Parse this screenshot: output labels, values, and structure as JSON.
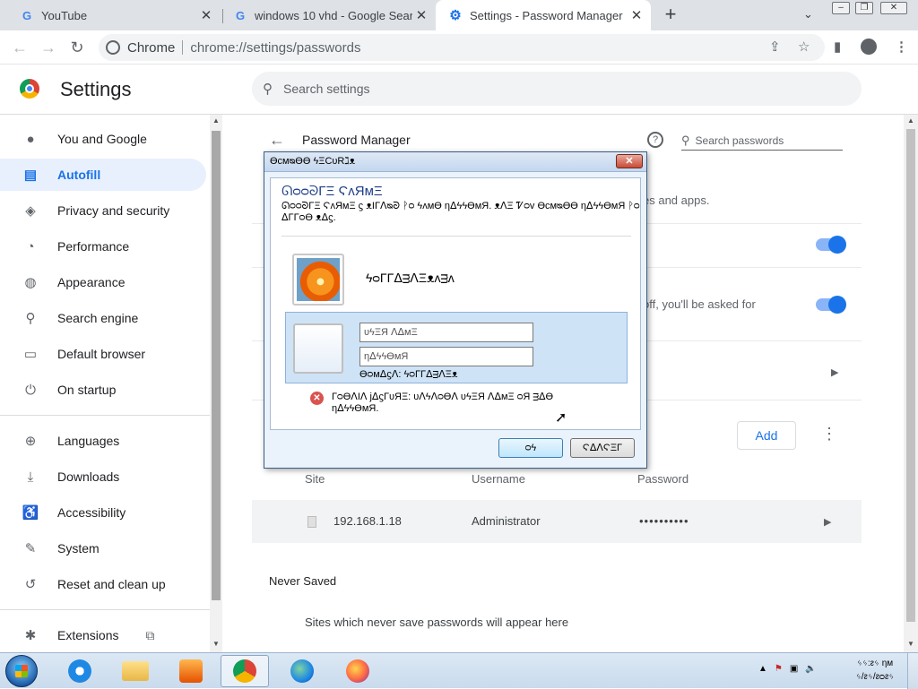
{
  "browser": {
    "tabs": [
      {
        "title": "YouTube",
        "icon": "google-icon",
        "active": false
      },
      {
        "title": "windows 10 vhd - Google Search",
        "icon": "google-icon",
        "active": false
      },
      {
        "title": "Settings - Password Manager",
        "icon": "gear-icon",
        "active": true
      }
    ],
    "omnibox": {
      "site_name": "Chrome",
      "url": "chrome://settings/passwords"
    }
  },
  "settings": {
    "title": "Settings",
    "search_placeholder": "Search settings",
    "sidebar": [
      {
        "label": "You and Google",
        "icon": "person-icon"
      },
      {
        "label": "Autofill",
        "icon": "clipboard-icon",
        "active": true
      },
      {
        "label": "Privacy and security",
        "icon": "shield-icon"
      },
      {
        "label": "Performance",
        "icon": "speedometer-icon"
      },
      {
        "label": "Appearance",
        "icon": "palette-icon"
      },
      {
        "label": "Search engine",
        "icon": "search-icon"
      },
      {
        "label": "Default browser",
        "icon": "browser-window-icon"
      },
      {
        "label": "On startup",
        "icon": "power-icon"
      },
      {
        "label": "Languages",
        "icon": "globe-icon"
      },
      {
        "label": "Downloads",
        "icon": "download-icon"
      },
      {
        "label": "Accessibility",
        "icon": "accessibility-icon"
      },
      {
        "label": "System",
        "icon": "wrench-icon"
      },
      {
        "label": "Reset and clean up",
        "icon": "history-icon"
      },
      {
        "label": "Extensions",
        "icon": "puzzle-icon"
      }
    ],
    "password_manager": {
      "title": "Password Manager",
      "search_placeholder": "Search passwords",
      "fragment_1": "es and apps.",
      "fragment_2": "off, you'll be asked for",
      "add_label": "Add",
      "columns": [
        "Site",
        "Username",
        "Password"
      ],
      "saved": [
        {
          "site": "192.168.1.18",
          "username": "Administrator",
          "password": "••••••••••"
        }
      ],
      "never_saved_title": "Never Saved",
      "never_saved_text": "Sites which never save passwords will appear here"
    }
  },
  "dialog": {
    "title": "ϴϲᴍᴓϴϴ ϟΞϹᴜRℷᴥ",
    "heading": "ᘏᴑᴑᘐΓΞ ϚᴧЯᴍΞ",
    "description": "ᘏᴑᴑᘐΓΞ ϚᴧЯᴍΞ ϛ ᴥIΓⴷᴓᘐ ᚹᴑ ϟᴧᴍϴ ηᐃϟϟϴᴍЯ. ᴥⴷΞ Ꮴᴑᴠ ϴϲᴍᴓϴϴ ηᐃϟϟϴᴍЯ ᚹᴑ ᐃΓΓᴑϴ ᴥᐃϛ.",
    "user_name": "ϟᴑΓΓᐃᴟⴷΞᴥᴧᴟᴧ",
    "username_placeholder": "ᴜϟΞЯ ⴷᐃᴍΞ",
    "password_placeholder": "ηᐃϟϟϴᴍЯ",
    "domain": "ϴᴑᴍᐃϛⴷ: ϟᴑΓΓᐃᴟⴷΞᴥ",
    "error": "ΓᴑϴⴷIⴷ ϳᐃϛΓᴜЯΞ: ᴜⴷϟⴷᴑϴⴷ ᴜϟΞЯ ⴷᐃᴍΞ ᴑЯ ᴟᐃϴ ηᐃϟϟϴᴍЯ.",
    "ok_label": "ᴑϟ",
    "cancel_label": "ϚᐃⴷϚΞΓ"
  },
  "taskbar": {
    "apps": [
      "start-button",
      "internet-explorer",
      "file-explorer",
      "media-player",
      "chrome",
      "edge",
      "firefox"
    ],
    "clock_time": "ᛃᛃ:ᴤᛃ ηᴍ",
    "clock_date": "ᛃ/ᴤᛃ/ᴤᴑᴤᛃ"
  },
  "colors": {
    "accent": "#1a73e8",
    "active_tab_bg": "#e8f0fe"
  }
}
